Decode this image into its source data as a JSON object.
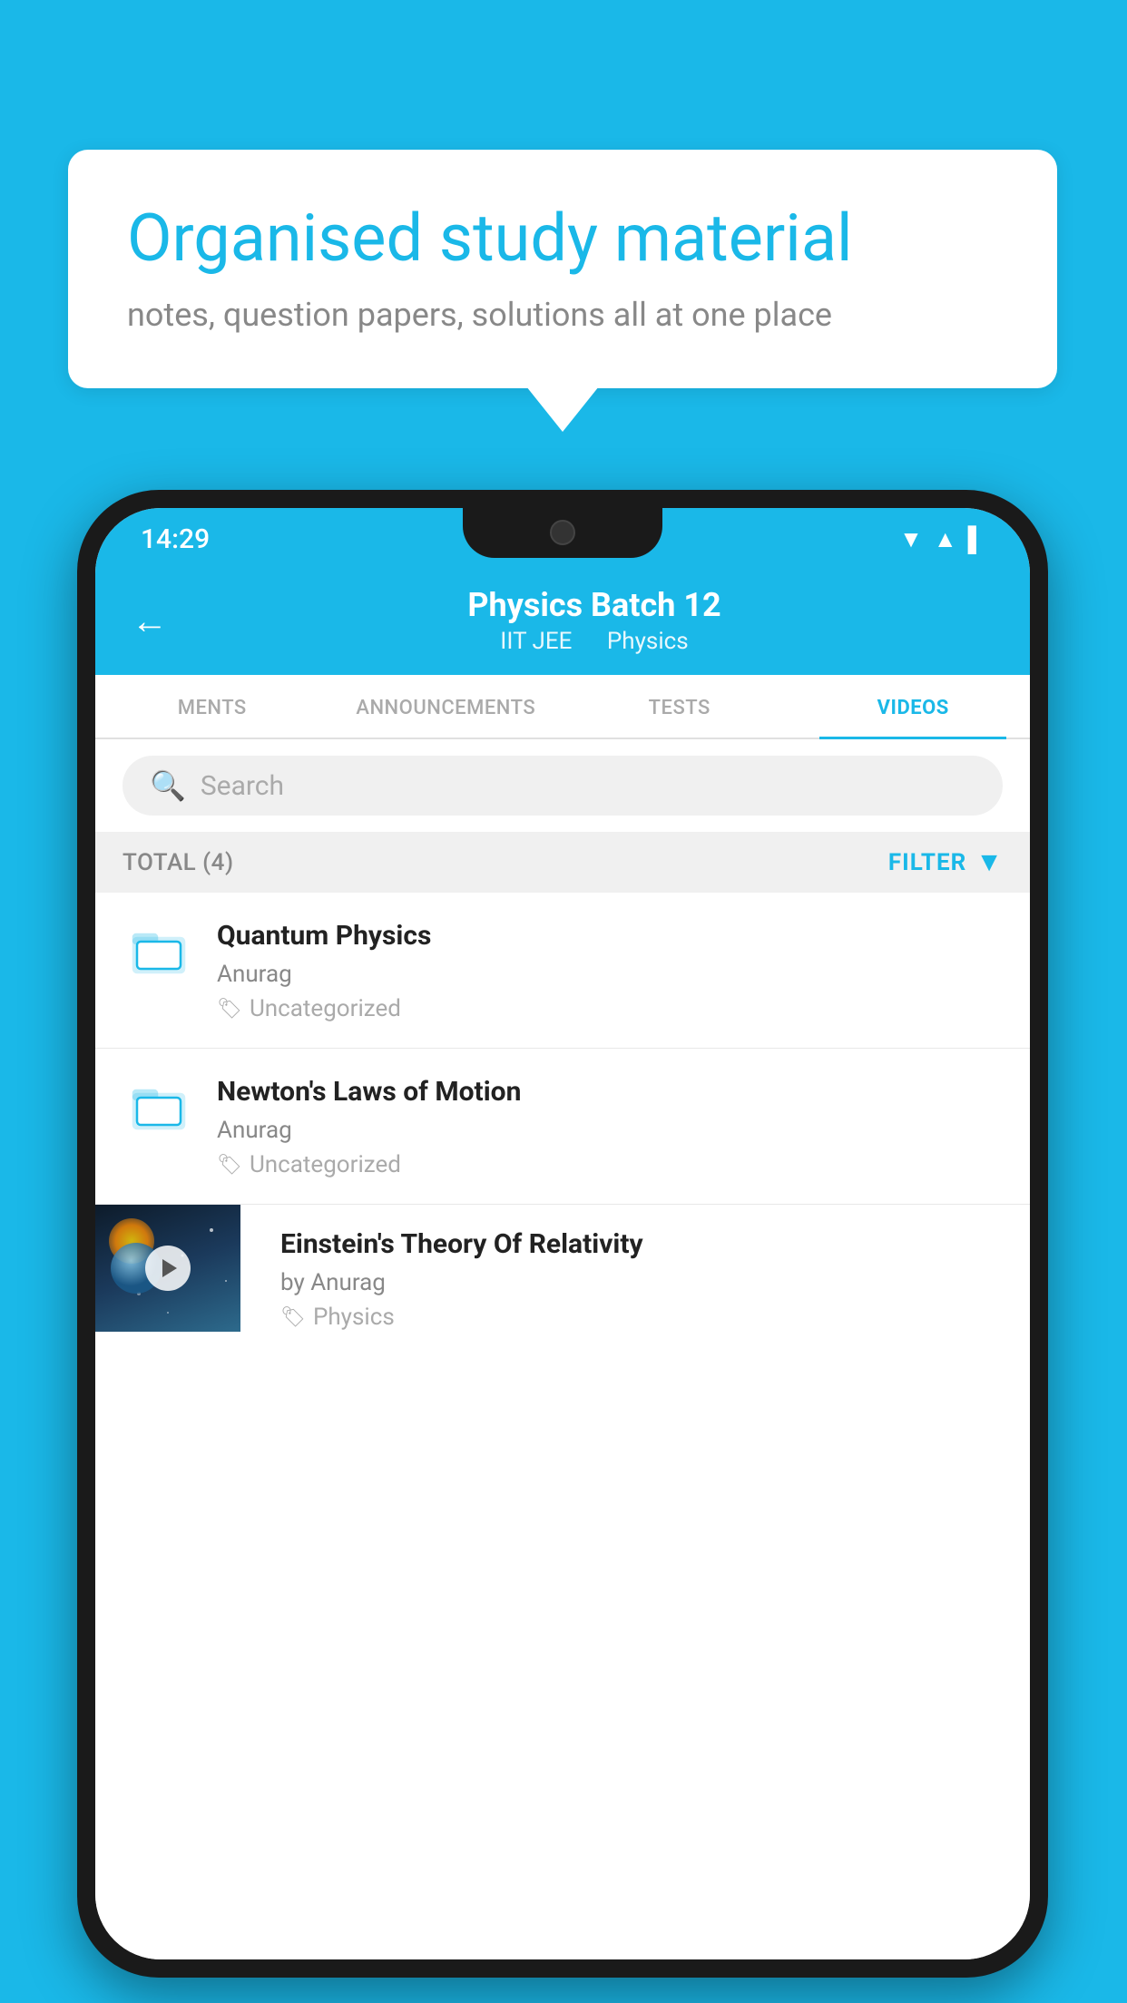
{
  "background_color": "#1ab8e8",
  "speech_bubble": {
    "title": "Organised study material",
    "subtitle": "notes, question papers, solutions all at one place"
  },
  "phone": {
    "status_bar": {
      "time": "14:29",
      "icons": [
        "wifi",
        "signal",
        "battery"
      ]
    },
    "header": {
      "title": "Physics Batch 12",
      "subtitle_part1": "IIT JEE",
      "subtitle_part2": "Physics",
      "back_label": "←"
    },
    "tabs": [
      {
        "label": "MENTS",
        "active": false
      },
      {
        "label": "ANNOUNCEMENTS",
        "active": false
      },
      {
        "label": "TESTS",
        "active": false
      },
      {
        "label": "VIDEOS",
        "active": true
      }
    ],
    "search": {
      "placeholder": "Search"
    },
    "filter_bar": {
      "total_label": "TOTAL (4)",
      "filter_label": "FILTER"
    },
    "videos": [
      {
        "id": 1,
        "title": "Quantum Physics",
        "author": "Anurag",
        "tag": "Uncategorized",
        "has_thumbnail": false
      },
      {
        "id": 2,
        "title": "Newton's Laws of Motion",
        "author": "Anurag",
        "tag": "Uncategorized",
        "has_thumbnail": false
      },
      {
        "id": 3,
        "title": "Einstein's Theory Of Relativity",
        "author": "by Anurag",
        "tag": "Physics",
        "has_thumbnail": true
      }
    ]
  }
}
